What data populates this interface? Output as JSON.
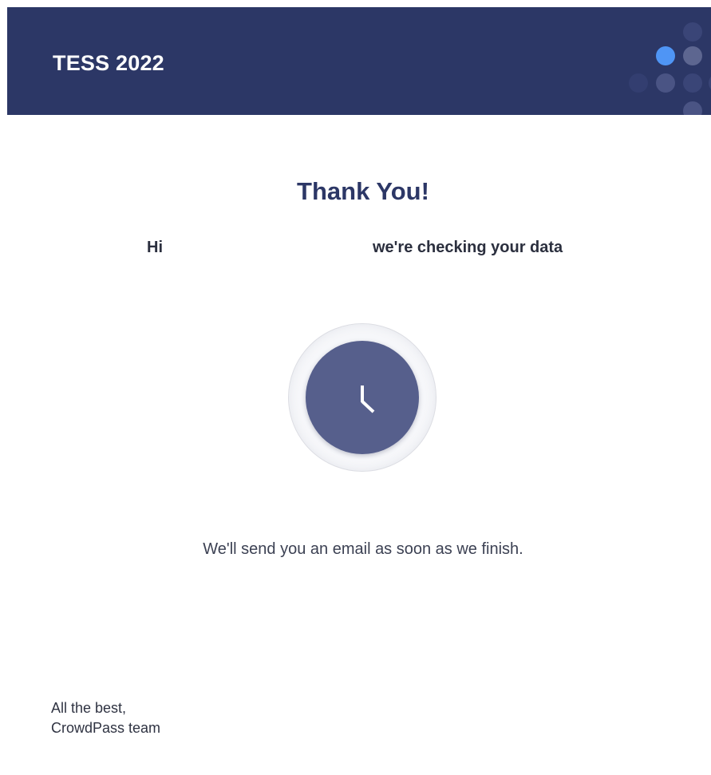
{
  "header": {
    "title": "TESS 2022",
    "background_color": "#2c3766",
    "accent_dot_color": "#4f95f5"
  },
  "main": {
    "title": "Thank You!",
    "greeting_hi": "Hi",
    "greeting_status": "we're checking your data",
    "status_icon": "clock-icon",
    "note": "We'll send you an email as soon as we finish."
  },
  "footer": {
    "signoff_line1": "All the best,",
    "signoff_line2": "CrowdPass team"
  }
}
